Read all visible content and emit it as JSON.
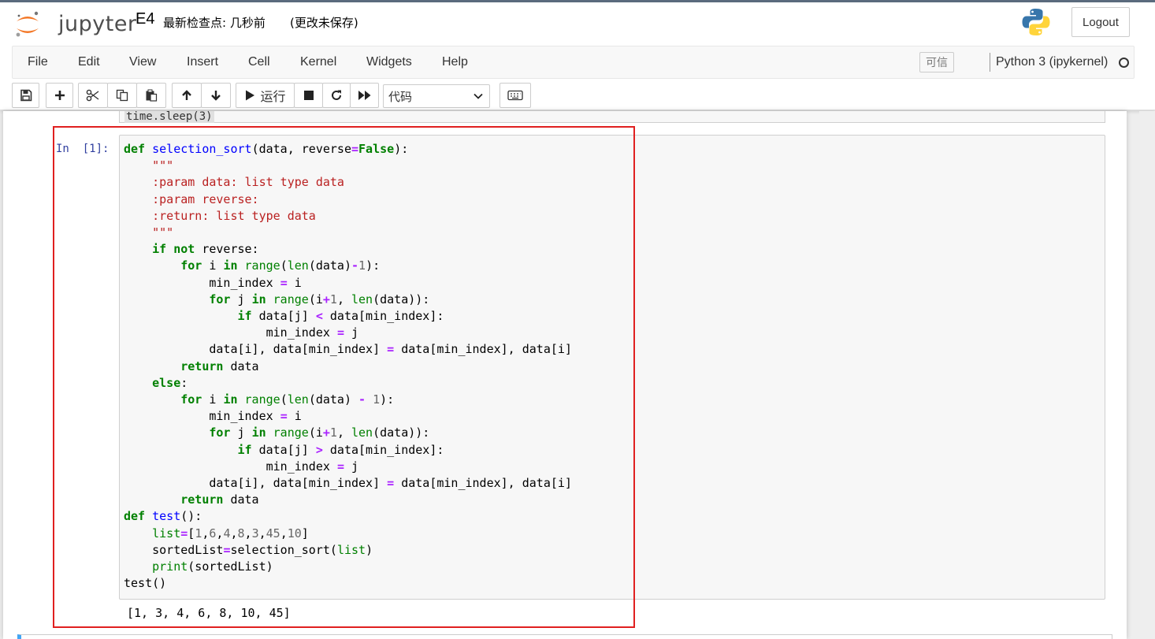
{
  "app": {
    "logo_text": "jupyter",
    "notebook_name": "E4",
    "checkpoint_text": "最新检查点: 几秒前",
    "autosave_text": "(更改未保存)",
    "logout_label": "Logout"
  },
  "menu": {
    "items": [
      "File",
      "Edit",
      "View",
      "Insert",
      "Cell",
      "Kernel",
      "Widgets",
      "Help"
    ],
    "trusted_label": "可信",
    "kernel_name": "Python 3 (ipykernel)"
  },
  "toolbar": {
    "run_label": "运行",
    "cell_type": "代码",
    "icons": [
      "save-icon",
      "plus-icon",
      "cut-icon",
      "copy-icon",
      "paste-icon",
      "arrow-up-icon",
      "arrow-down-icon",
      "play-icon",
      "stop-icon",
      "restart-icon",
      "fast-forward-icon",
      "keyboard-icon"
    ]
  },
  "cells": {
    "previous_code": "time.sleep(3)",
    "prompt": "In  [1]:",
    "code": "def selection_sort(data, reverse=False):\n    \"\"\"\n    :param data: list type data\n    :param reverse:\n    :return: list type data\n    \"\"\"\n    if not reverse:\n        for i in range(len(data)-1):\n            min_index = i\n            for j in range(i+1, len(data)):\n                if data[j] < data[min_index]:\n                    min_index = j\n            data[i], data[min_index] = data[min_index], data[i]\n        return data\n    else:\n        for i in range(len(data) - 1):\n            min_index = i\n            for j in range(i+1, len(data)):\n                if data[j] > data[min_index]:\n                    min_index = j\n            data[i], data[min_index] = data[min_index], data[i]\n        return data\ndef test():\n    list=[1,6,4,8,3,45,10]\n    sortedList=selection_sort(list)\n    print(sortedList)\ntest()",
    "output": "[1, 3, 4, 6, 8, 10, 45]"
  },
  "colors": {
    "keyword": "#008000",
    "function_name": "#0000ff",
    "docstring": "#ba2121",
    "prompt": "#303f9f",
    "highlight_border": "#e02020"
  }
}
